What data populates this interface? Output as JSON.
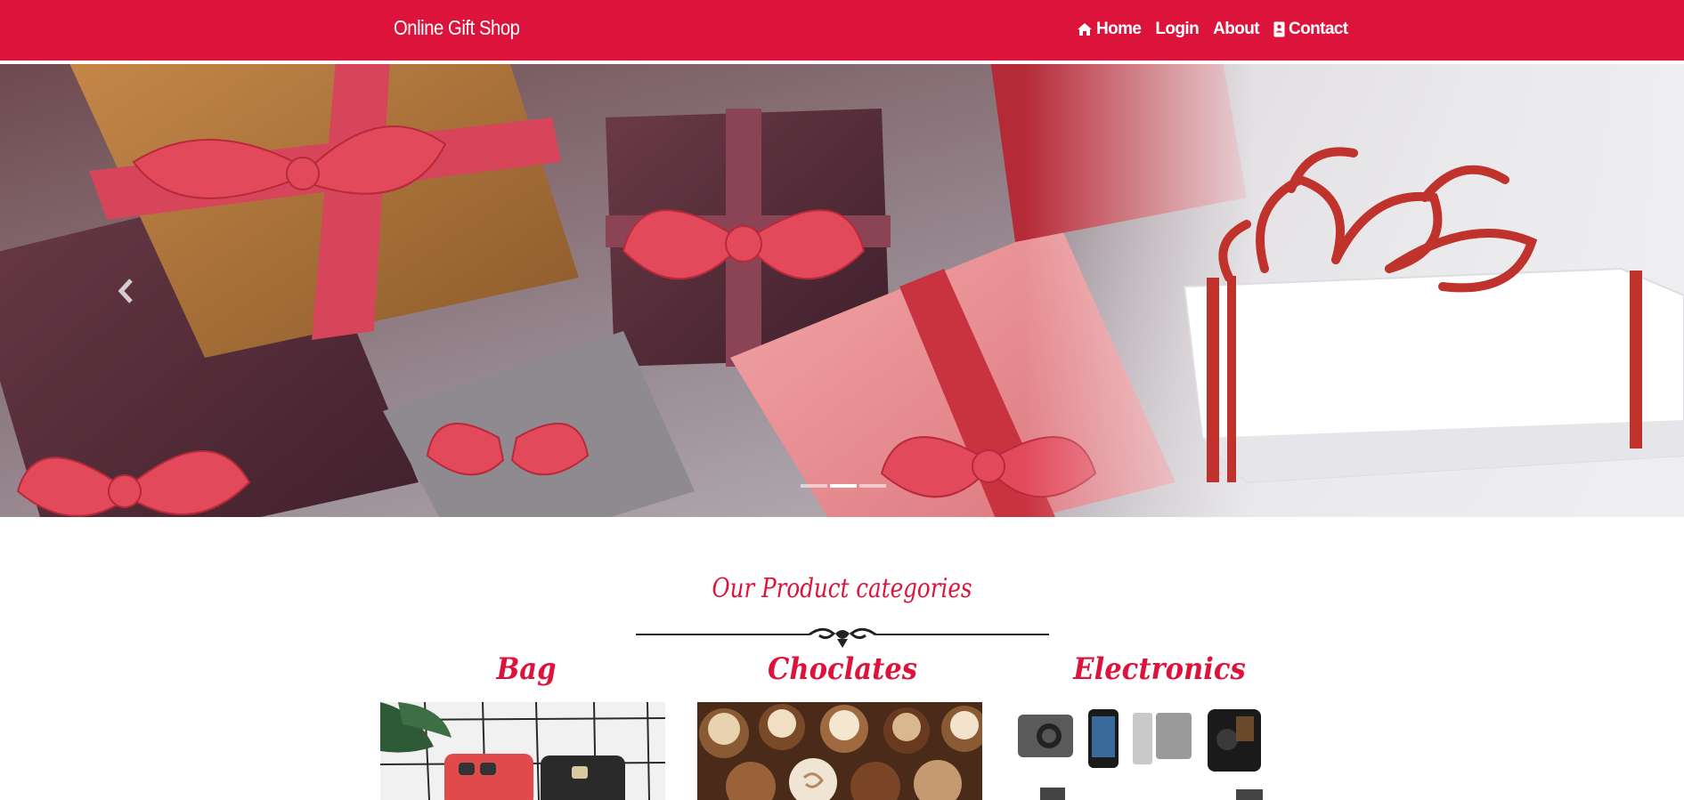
{
  "brand": "Online Gift Shop",
  "nav": {
    "home": "Home",
    "login": "Login",
    "about": "About",
    "contact": "Contact"
  },
  "carousel": {
    "slide_count": 3,
    "active_index": 1
  },
  "categories": {
    "title": "Our Product categories",
    "items": [
      {
        "name": "Bag"
      },
      {
        "name": "Choclates"
      },
      {
        "name": "Electronics"
      }
    ]
  },
  "colors": {
    "brand": "#dc143c",
    "background": "#ffffff"
  },
  "icons": {
    "home": "home-icon",
    "contact": "contact-card-icon",
    "prev": "chevron-left-icon",
    "next": "chevron-right-icon",
    "divider": "ornamental-divider"
  }
}
